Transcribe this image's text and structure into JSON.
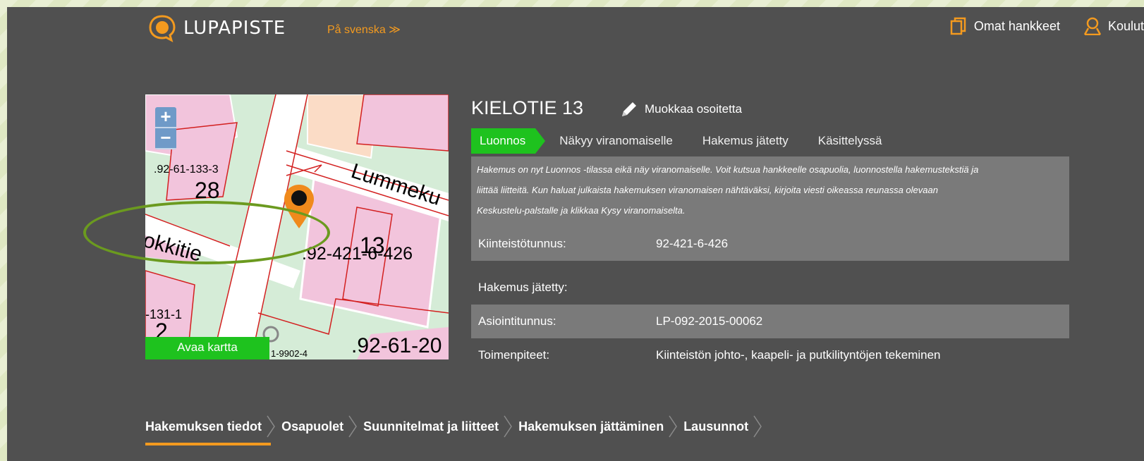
{
  "header": {
    "brand": "LUPAPISTE",
    "language_link": "På svenska ≫",
    "nav": [
      {
        "label": "Omat hankkeet",
        "icon": "documents-icon"
      },
      {
        "label": "Koulut",
        "icon": "user-icon"
      }
    ]
  },
  "map": {
    "zoom_in": "+",
    "zoom_out": "−",
    "labels": [
      ".92-61-133-3",
      "28",
      "Lummeku",
      "okkitie",
      ".92-421-6-426",
      "13",
      "-131-1",
      "2",
      "1-9902-4",
      ".92-61-20"
    ],
    "open_button": "Avaa kartta"
  },
  "project": {
    "title": "KIELOTIE 13",
    "edit_label": "Muokkaa osoitetta",
    "steps": [
      "Luonnos",
      "Näkyy viranomaiselle",
      "Hakemus jätetty",
      "Käsittelyssä"
    ],
    "active_step": "Luonnos",
    "notice_lines": [
      "Hakemus on nyt Luonnos -tilassa eikä näy viranomaiselle. Voit kutsua hankkeelle osapuolia, luonnostella hakemustekstiä ja",
      "liittää liitteitä. Kun haluat julkaista hakemuksen viranomaisen nähtäväksi, kirjoita viesti oikeassa reunassa olevaan",
      "Keskustelu-palstalle ja klikkaa Kysy viranomaiselta."
    ],
    "fields": [
      {
        "label": "Kiinteistötunnus:",
        "value": "92-421-6-426"
      },
      {
        "label": "Hakemus jätetty:",
        "value": ""
      },
      {
        "label": "Asiointitunnus:",
        "value": "LP-092-2015-00062"
      },
      {
        "label": "Toimenpiteet:",
        "value": "Kiinteistön johto-, kaapeli- ja putkilityntöjen tekeminen"
      }
    ]
  },
  "tabs": [
    "Hakemuksen tiedot",
    "Osapuolet",
    "Suunnitelmat ja liitteet",
    "Hakemuksen jättäminen",
    "Lausunnot"
  ],
  "colors": {
    "background": "#505050",
    "accent_orange": "#f39a1f",
    "status_green": "#1ec21e",
    "panel_gray": "#7a7a7a",
    "highlight_ellipse": "#6b9a1f"
  }
}
